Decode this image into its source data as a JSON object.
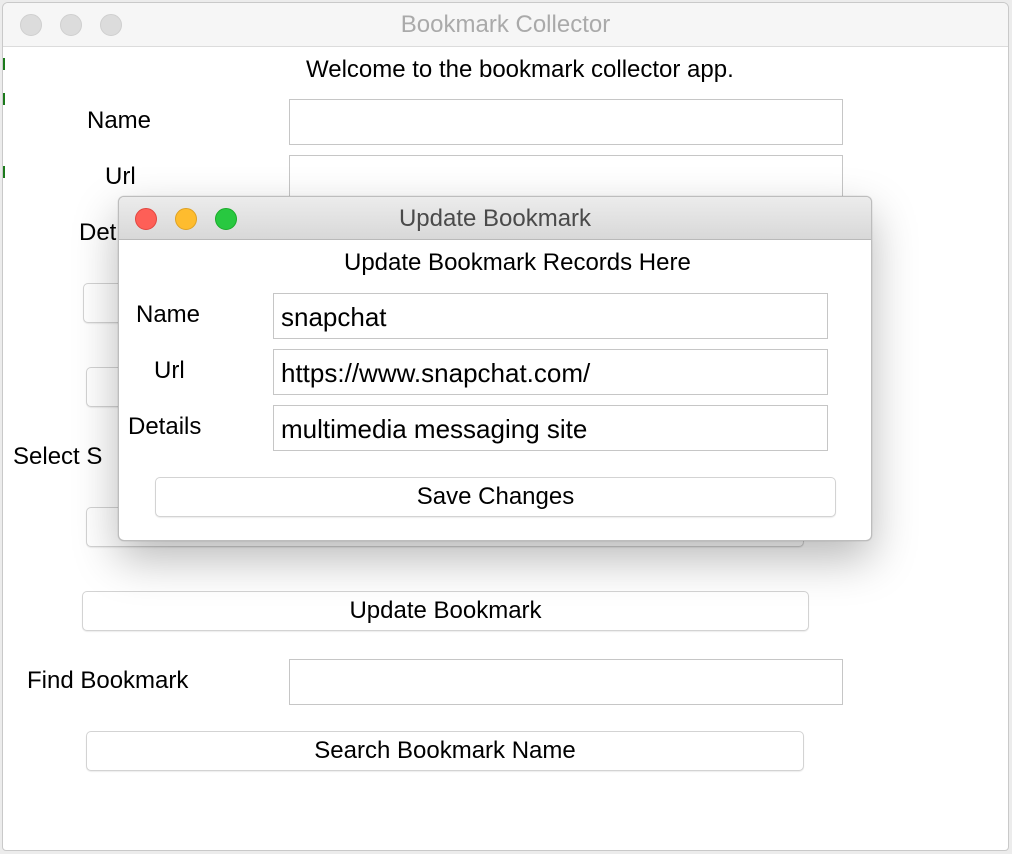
{
  "main_window": {
    "title": "Bookmark Collector",
    "welcome": "Welcome to the bookmark collector app.",
    "labels": {
      "name": "Name",
      "url": "Url",
      "details_partial": "Det",
      "select_partial": "Select S",
      "find_bookmark": "Find Bookmark"
    },
    "fields": {
      "name": "",
      "url": "",
      "find": ""
    },
    "buttons": {
      "update_bookmark": "Update Bookmark",
      "search_bookmark_name": "Search Bookmark Name"
    }
  },
  "dialog": {
    "title": "Update Bookmark",
    "heading": "Update Bookmark Records Here",
    "labels": {
      "name": "Name",
      "url": "Url",
      "details": "Details"
    },
    "fields": {
      "name": "snapchat",
      "url": "https://www.snapchat.com/",
      "details": "multimedia messaging site"
    },
    "save_button": "Save Changes"
  },
  "colors": {
    "close": "#fe5f57",
    "minimize": "#febc2e",
    "maximize": "#28c840"
  }
}
